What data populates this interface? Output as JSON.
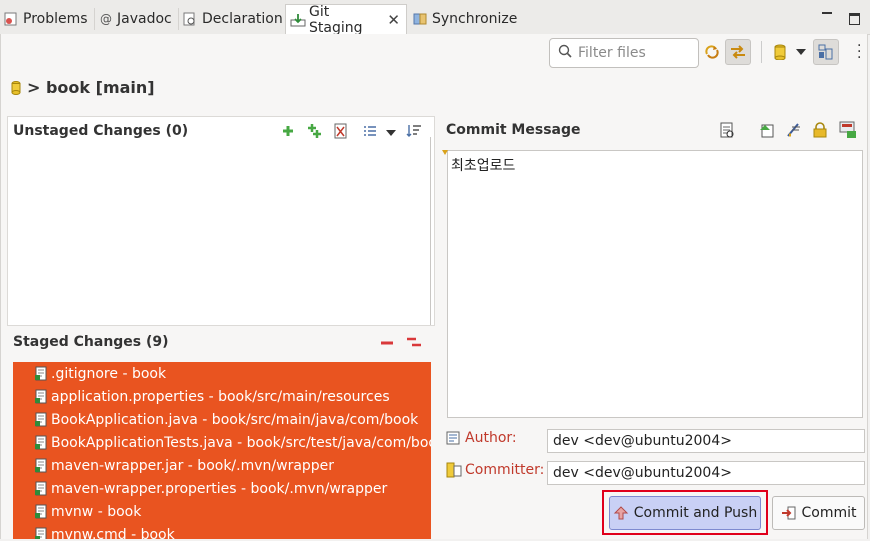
{
  "tabs": [
    {
      "label": "Problems",
      "icon": "problems-icon"
    },
    {
      "label": "Javadoc",
      "icon": "at-icon"
    },
    {
      "label": "Declaration",
      "icon": "declaration-icon"
    },
    {
      "label": "Git Staging",
      "icon": "git-staging-icon",
      "active": true
    },
    {
      "label": "Synchronize",
      "icon": "synchronize-icon"
    }
  ],
  "toolbar": {
    "filter_placeholder": "Filter files"
  },
  "repo": {
    "title": "> book [main]"
  },
  "unstaged": {
    "title": "Unstaged Changes (0)"
  },
  "staged": {
    "title": "Staged Changes (9)",
    "highlight_color": "#e95420",
    "items": [
      ".gitignore - book",
      "application.properties - book/src/main/resources",
      "BookApplication.java - book/src/main/java/com/book",
      "BookApplicationTests.java - book/src/test/java/com/book",
      "maven-wrapper.jar - book/.mvn/wrapper",
      "maven-wrapper.properties - book/.mvn/wrapper",
      "mvnw - book",
      "mvnw.cmd - book"
    ]
  },
  "commit": {
    "title": "Commit Message",
    "message": "최초업로드",
    "author_label": "Author:",
    "author_value": "dev <dev@ubuntu2004>",
    "committer_label": "Committer:",
    "committer_value": "dev <dev@ubuntu2004>",
    "commit_push_label": "Commit and Push",
    "commit_label": "Commit",
    "highlight_color": "#e0001b"
  }
}
